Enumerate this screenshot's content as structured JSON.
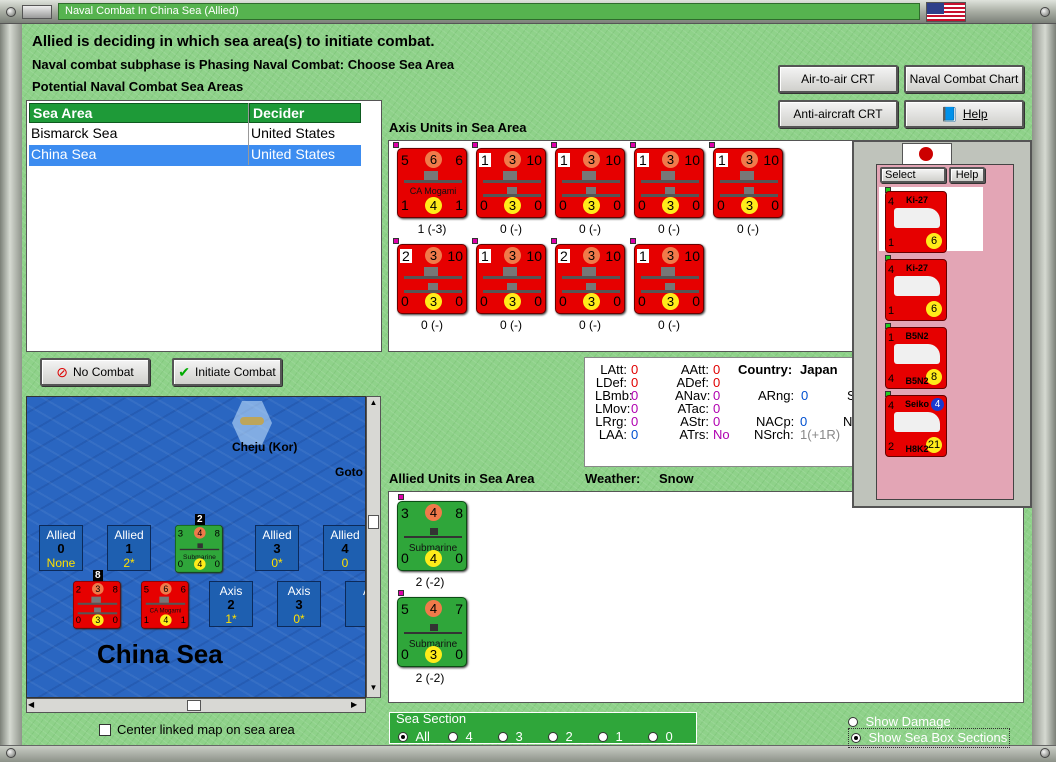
{
  "window": {
    "title": "Naval Combat In China Sea (Allied)"
  },
  "header": {
    "line1": "Allied is deciding in which sea area(s) to initiate combat.",
    "line2": "Naval combat subphase is Phasing Naval Combat: Choose Sea Area",
    "line3": "Potential Naval Combat Sea Areas"
  },
  "buttons": {
    "air_to_air": "Air-to-air CRT",
    "naval_chart": "Naval Combat Chart",
    "anti_aircraft": "Anti-aircraft CRT",
    "help": "Help",
    "no_combat": "No Combat",
    "initiate_combat": "Initiate Combat"
  },
  "sea_table": {
    "headers": [
      "Sea Area",
      "Decider"
    ],
    "rows": [
      {
        "area": "Bismarck Sea",
        "decider": "United States"
      },
      {
        "area": "China Sea",
        "decider": "United States"
      }
    ]
  },
  "axis": {
    "label": "Axis Units in Sea Area",
    "units": [
      {
        "tl": "5",
        "top": "6",
        "tr": "6",
        "bl": "1",
        "bot": "4",
        "br": "1",
        "name": "CA Mogami",
        "under": "1 (-3)",
        "boxed": false
      },
      {
        "tl": "1",
        "top": "3",
        "tr": "10",
        "bl": "0",
        "bot": "3",
        "br": "0",
        "name": "",
        "under": "0 (-)",
        "boxed": true
      },
      {
        "tl": "1",
        "top": "3",
        "tr": "10",
        "bl": "0",
        "bot": "3",
        "br": "0",
        "name": "",
        "under": "0 (-)",
        "boxed": true
      },
      {
        "tl": "1",
        "top": "3",
        "tr": "10",
        "bl": "0",
        "bot": "3",
        "br": "0",
        "name": "",
        "under": "0 (-)",
        "boxed": true
      },
      {
        "tl": "1",
        "top": "3",
        "tr": "10",
        "bl": "0",
        "bot": "3",
        "br": "0",
        "name": "",
        "under": "0 (-)",
        "boxed": true
      },
      {
        "tl": "2",
        "top": "3",
        "tr": "10",
        "bl": "0",
        "bot": "3",
        "br": "0",
        "name": "",
        "under": "0 (-)",
        "boxed": true
      },
      {
        "tl": "1",
        "top": "3",
        "tr": "10",
        "bl": "0",
        "bot": "3",
        "br": "0",
        "name": "",
        "under": "0 (-)",
        "boxed": true
      },
      {
        "tl": "2",
        "top": "3",
        "tr": "10",
        "bl": "0",
        "bot": "3",
        "br": "0",
        "name": "",
        "under": "0 (-)",
        "boxed": true
      },
      {
        "tl": "1",
        "top": "3",
        "tr": "10",
        "bl": "0",
        "bot": "3",
        "br": "0",
        "name": "",
        "under": "0 (-)",
        "boxed": true
      }
    ]
  },
  "stats": {
    "col1": [
      {
        "k": "LAtt:",
        "v": "0",
        "c": "#e00000"
      },
      {
        "k": "LDef:",
        "v": "0",
        "c": "#e00000"
      },
      {
        "k": "LBmb:",
        "v": "0",
        "c": "#b000b0"
      },
      {
        "k": "LMov:",
        "v": "0",
        "c": "#b000b0"
      },
      {
        "k": "LRrg:",
        "v": "0",
        "c": "#b000b0"
      },
      {
        "k": "LAA:",
        "v": "0",
        "c": "#0050d0"
      }
    ],
    "col2": [
      {
        "k": "AAtt:",
        "v": "0",
        "c": "#e00000"
      },
      {
        "k": "ADef:",
        "v": "0",
        "c": "#e00000"
      },
      {
        "k": "ANav:",
        "v": "0",
        "c": "#b000b0"
      },
      {
        "k": "ATac:",
        "v": "0",
        "c": "#b000b0"
      },
      {
        "k": "AStr:",
        "v": "0",
        "c": "#b000b0"
      },
      {
        "k": "ATrs:",
        "v": "No",
        "c": "#b000b0"
      }
    ],
    "country_label": "Country:",
    "country": "Japan",
    "arng_label": "ARng:",
    "arng": "0",
    "nacp_label": "NACp:",
    "nacp": "0",
    "nsrch_label": "NSrch:",
    "nsrch": "1(+1R)",
    "trunc1": "S",
    "trunc2": "N"
  },
  "allied": {
    "label": "Allied Units in Sea Area",
    "weather_label": "Weather:",
    "weather": "Snow",
    "units": [
      {
        "tl": "3",
        "top": "4",
        "tr": "8",
        "bl": "0",
        "bot": "4",
        "br": "0",
        "name": "Submarine",
        "under": "2 (-2)"
      },
      {
        "tl": "5",
        "top": "4",
        "tr": "7",
        "bl": "0",
        "bot": "3",
        "br": "0",
        "name": "Submarine",
        "under": "2 (-2)"
      }
    ]
  },
  "map": {
    "island": "Cheju (Kor)",
    "goto": "Goto",
    "sea_name": "China Sea",
    "allied_boxes": [
      {
        "side": "Allied",
        "num": "0",
        "sub": "None"
      },
      {
        "side": "Allied",
        "num": "1",
        "sub": "2*"
      },
      {
        "side": "Allied",
        "num": "3",
        "sub": "0*"
      },
      {
        "side": "Allied",
        "num": "4",
        "sub": "0"
      }
    ],
    "axis_boxes": [
      {
        "side": "Axis",
        "num": "2",
        "sub": "1*"
      },
      {
        "side": "Axis",
        "num": "3",
        "sub": "0*"
      },
      {
        "side": "A",
        "num": "",
        "sub": ""
      }
    ],
    "stack_allied": {
      "tl": "3",
      "top": "4",
      "tr": "8",
      "bl": "0",
      "bot": "4",
      "br": "0",
      "name": "Submarine",
      "count": "2"
    },
    "stack_axis1": {
      "tl": "2",
      "top": "3",
      "tr": "8",
      "bl": "0",
      "bot": "3",
      "br": "0",
      "count": "8"
    },
    "stack_axis2": {
      "tl": "5",
      "top": "6",
      "tr": "6",
      "bl": "1",
      "bot": "4",
      "br": "1",
      "name": "CA Mogami"
    }
  },
  "center_map": "Center linked map on sea area",
  "sea_section": {
    "label": "Sea Section",
    "options": [
      "All",
      "4",
      "3",
      "2",
      "1",
      "0"
    ],
    "selected": "All"
  },
  "show_damage": "Show Damage",
  "show_sections": "Show Sea Box Sections",
  "jp_popup": {
    "select": "Select",
    "help": "Help",
    "aircraft": [
      {
        "name": "Ki-27",
        "tl": "4",
        "bl": "1",
        "circle": "6"
      },
      {
        "name": "Ki-27",
        "tl": "4",
        "bl": "1",
        "circle": "6"
      },
      {
        "name": "B5N2",
        "tl": "1",
        "bl": "4",
        "circle": "8"
      },
      {
        "name": "H8K2",
        "tl": "4",
        "bl": "2",
        "circle": "21",
        "top": "Seiko",
        "badge": "4"
      }
    ]
  }
}
